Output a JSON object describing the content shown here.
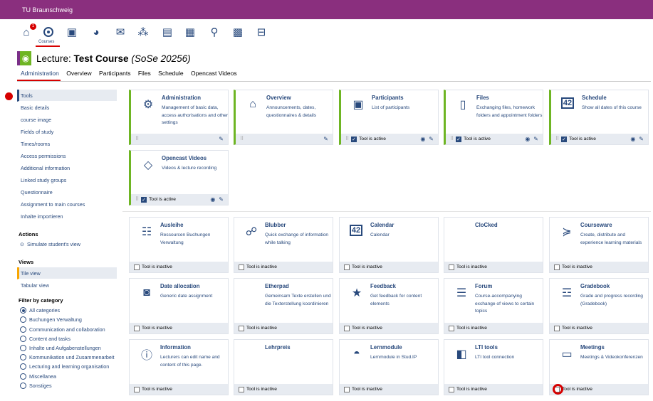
{
  "topbar": {
    "title": "TU Braunschweig"
  },
  "nav": {
    "courses_label": "Courses",
    "badge": "1"
  },
  "course": {
    "prefix": "Lecture:",
    "name": "Test Course",
    "semester": "(SoSe 20256)"
  },
  "tabs": [
    "Administration",
    "Overview",
    "Participants",
    "Files",
    "Schedule",
    "Opencast Videos"
  ],
  "sidebar": {
    "items": [
      "Tools",
      "Basic details",
      "course image",
      "Fields of study",
      "Times/rooms",
      "Access permissions",
      "Additional information",
      "Linked study groups",
      "Questionnaire",
      "Assignment to main courses",
      "Inhalte importieren"
    ],
    "actions_head": "Actions",
    "simulate": "Simulate student's view",
    "views_head": "Views",
    "tile_view": "Tile view",
    "tabular_view": "Tabular view",
    "filter_head": "Filter by category",
    "categories": [
      "All categories",
      "Buchungen Verwaltung",
      "Communication and collaboration",
      "Content and tasks",
      "Inhalte und Aufgabenstellungen",
      "Kommunikation und Zusammenarbeit",
      "Lecturing and learning organisation",
      "Miscellanea",
      "Sonstiges"
    ]
  },
  "active_tiles": [
    {
      "title": "Administration",
      "desc": "Management of basic data, access authorisations and other settings",
      "icon": "gears-icon",
      "status": ""
    },
    {
      "title": "Overview",
      "desc": "Announcements, dates, questionnaires & details",
      "icon": "home-icon",
      "status": ""
    },
    {
      "title": "Participants",
      "desc": "List of participants",
      "icon": "participants-icon",
      "status": "Tool is active"
    },
    {
      "title": "Files",
      "desc": "Exchanging files, homework folders and appointment folders",
      "icon": "file-icon",
      "status": "Tool is active"
    },
    {
      "title": "Schedule",
      "desc": "Show all dates of this course",
      "icon": "calendar-42-icon",
      "status": "Tool is active"
    },
    {
      "title": "Opencast Videos",
      "desc": "Videos & lecture recording",
      "icon": "opencast-icon",
      "status": "Tool is active"
    }
  ],
  "inactive_tiles": [
    {
      "title": "Ausleihe",
      "desc": "Ressourcen Buchungen Verwaltung",
      "icon": "booking-icon"
    },
    {
      "title": "Blubber",
      "desc": "Quick exchange of information while talking",
      "icon": "blubber-icon"
    },
    {
      "title": "Calendar",
      "desc": "Calendar",
      "icon": "calendar-42-icon"
    },
    {
      "title": "CloCked",
      "desc": "",
      "icon": ""
    },
    {
      "title": "Courseware",
      "desc": "Create, distribute and experience learning materials",
      "icon": "courseware-icon"
    },
    {
      "title": "Date allocation",
      "desc": "Generic date assignment",
      "icon": "date-allocation-icon"
    },
    {
      "title": "Etherpad",
      "desc": "Gemeinsam Texte erstellen und die Texterstellung koordinieren",
      "icon": ""
    },
    {
      "title": "Feedback",
      "desc": "Get feedback for content elements",
      "icon": "star-icon"
    },
    {
      "title": "Forum",
      "desc": "Course-accompanying exchange of views to certain topics",
      "icon": "forum-icon"
    },
    {
      "title": "Gradebook",
      "desc": "Grade and progress recording (Gradebook)",
      "icon": "gradebook-icon"
    },
    {
      "title": "Information",
      "desc": "Lecturers can edit name and content of this page.",
      "icon": "info-icon"
    },
    {
      "title": "Lehrpreis",
      "desc": "",
      "icon": ""
    },
    {
      "title": "Lernmodule",
      "desc": "Lernmodule in Stud.IP",
      "icon": "lernmodule-icon"
    },
    {
      "title": "LTI tools",
      "desc": "LTI tool connection",
      "icon": "lti-icon"
    },
    {
      "title": "Meetings",
      "desc": "Meetings & Videokonferenzen",
      "icon": "meetings-icon"
    }
  ],
  "inactive_status": "Tool is inactive"
}
